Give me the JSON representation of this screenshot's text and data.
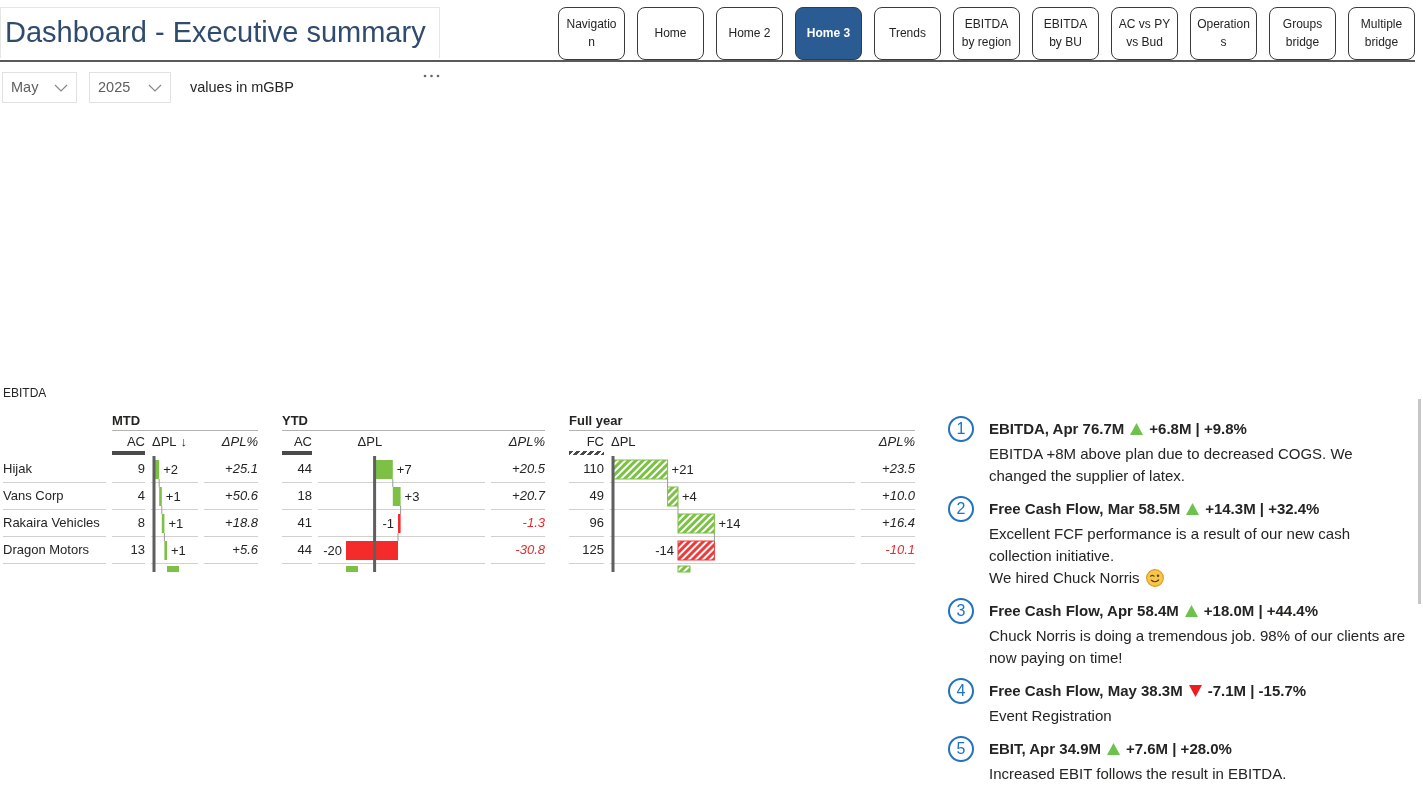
{
  "header": {
    "title": "Dashboard - Executive summary"
  },
  "nav_buttons": [
    {
      "label": "Navigation",
      "selected": false
    },
    {
      "label": "Home",
      "selected": false
    },
    {
      "label": "Home 2",
      "selected": false
    },
    {
      "label": "Home 3",
      "selected": true
    },
    {
      "label": "Trends",
      "selected": false
    },
    {
      "label": "EBITDA by region",
      "selected": false
    },
    {
      "label": "EBITDA by BU",
      "selected": false
    },
    {
      "label": "AC vs PY vs Bud",
      "selected": false
    },
    {
      "label": "Operations",
      "selected": false
    },
    {
      "label": "Groups bridge",
      "selected": false
    },
    {
      "label": "Multiple bridge",
      "selected": false
    }
  ],
  "filters": {
    "month": {
      "value": "May"
    },
    "year": {
      "value": "2025"
    },
    "units_note": "values in mGBP"
  },
  "ebitda_table": {
    "title": "EBITDA",
    "row_labels": [
      "Hijak",
      "Vans Corp",
      "Rakaira Vehicles",
      "Dragon Motors"
    ],
    "sections": [
      {
        "title": "MTD",
        "kind": "actual",
        "value_header": "AC",
        "delta_header": "ΔPL",
        "sort_mark": "↓",
        "percent_header": "ΔPL%",
        "values": [
          "9",
          "4",
          "8",
          "13"
        ],
        "deltas": [
          "+2",
          "+1",
          "+1",
          "+1"
        ],
        "percents": [
          "+25.1",
          "+50.6",
          "+18.8",
          "+5.6"
        ]
      },
      {
        "title": "YTD",
        "kind": "actual",
        "value_header": "AC",
        "delta_header": "ΔPL",
        "percent_header": "ΔPL%",
        "values": [
          "44",
          "18",
          "41",
          "44"
        ],
        "deltas": [
          "+7",
          "+3",
          "-1",
          "-20"
        ],
        "percents": [
          "+20.5",
          "+20.7",
          "-1.3",
          "-30.8"
        ]
      },
      {
        "title": "Full year",
        "kind": "forecast",
        "value_header": "FC",
        "delta_header": "ΔPL",
        "percent_header": "ΔPL%",
        "values": [
          "110",
          "49",
          "96",
          "125"
        ],
        "deltas": [
          "+21",
          "+4",
          "+14",
          "-14"
        ],
        "percents": [
          "+23.5",
          "+10.0",
          "+16.4",
          "-10.1"
        ]
      }
    ]
  },
  "comments": [
    {
      "number": "1",
      "title": "EBITDA, Apr 76.7M",
      "kind": "increase",
      "change": "+6.8M | +9.8%",
      "body": [
        {
          "kind": "plain",
          "text": "EBITDA +8M above plan due to decreased COGS. We changed the supplier of latex."
        }
      ]
    },
    {
      "number": "2",
      "title": "Free Cash Flow, Mar 58.5M",
      "kind": "increase",
      "change": "+14.3M | +32.4%",
      "body": [
        {
          "kind": "plain",
          "text": "Excellent FCF performance is a result of our new cash collection initiative."
        },
        {
          "kind": "with_emoji",
          "text": "We hired Chuck Norris"
        }
      ]
    },
    {
      "number": "3",
      "title": "Free Cash Flow, Apr 58.4M",
      "kind": "increase",
      "change": "+18.0M | +44.4%",
      "body": [
        {
          "kind": "plain",
          "text": "Chuck Norris is doing a tremendous job. 98% of our clients are now paying on time!"
        }
      ]
    },
    {
      "number": "4",
      "title": "Free Cash Flow, May 38.3M",
      "kind": "decrease",
      "change": "-7.1M | -15.7%",
      "body": [
        {
          "kind": "plain",
          "text": "Event Registration"
        }
      ]
    },
    {
      "number": "5",
      "title": "EBIT, Apr 34.9M",
      "kind": "increase",
      "change": "+7.6M | +28.0%",
      "body": [
        {
          "kind": "plain",
          "text": "Increased EBIT follows the result in EBITDA."
        }
      ]
    }
  ]
}
